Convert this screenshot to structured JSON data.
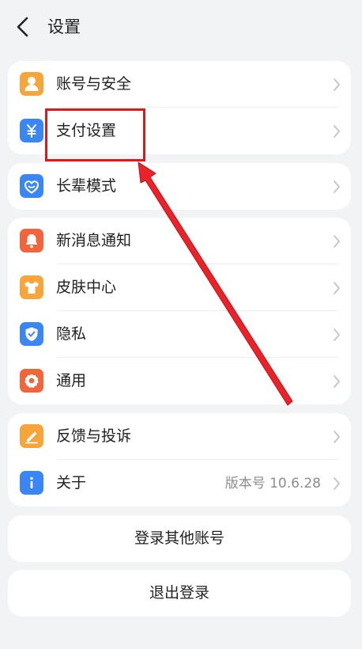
{
  "header": {
    "title": "设置"
  },
  "groups": [
    {
      "items": [
        {
          "label": "账号与安全",
          "icon": "user-icon",
          "color": "#f7a43a"
        },
        {
          "label": "支付设置",
          "icon": "yuan-icon",
          "color": "#3a86f5"
        }
      ]
    },
    {
      "items": [
        {
          "label": "长辈模式",
          "icon": "heart-icon",
          "color": "#3a86f5"
        }
      ]
    },
    {
      "items": [
        {
          "label": "新消息通知",
          "icon": "bell-icon",
          "color": "#f2653a"
        },
        {
          "label": "皮肤中心",
          "icon": "shirt-icon",
          "color": "#f7a43a"
        },
        {
          "label": "隐私",
          "icon": "shield-icon",
          "color": "#3a86f5"
        },
        {
          "label": "通用",
          "icon": "gear-icon",
          "color": "#f2653a"
        }
      ]
    },
    {
      "items": [
        {
          "label": "反馈与投诉",
          "icon": "edit-icon",
          "color": "#f7a43a"
        },
        {
          "label": "关于",
          "icon": "info-icon",
          "color": "#3a86f5",
          "value": "版本号 10.6.28"
        }
      ]
    }
  ],
  "buttons": {
    "switch_account": "登录其他账号",
    "logout": "退出登录"
  },
  "annotation": {
    "color": "#e0161d"
  }
}
